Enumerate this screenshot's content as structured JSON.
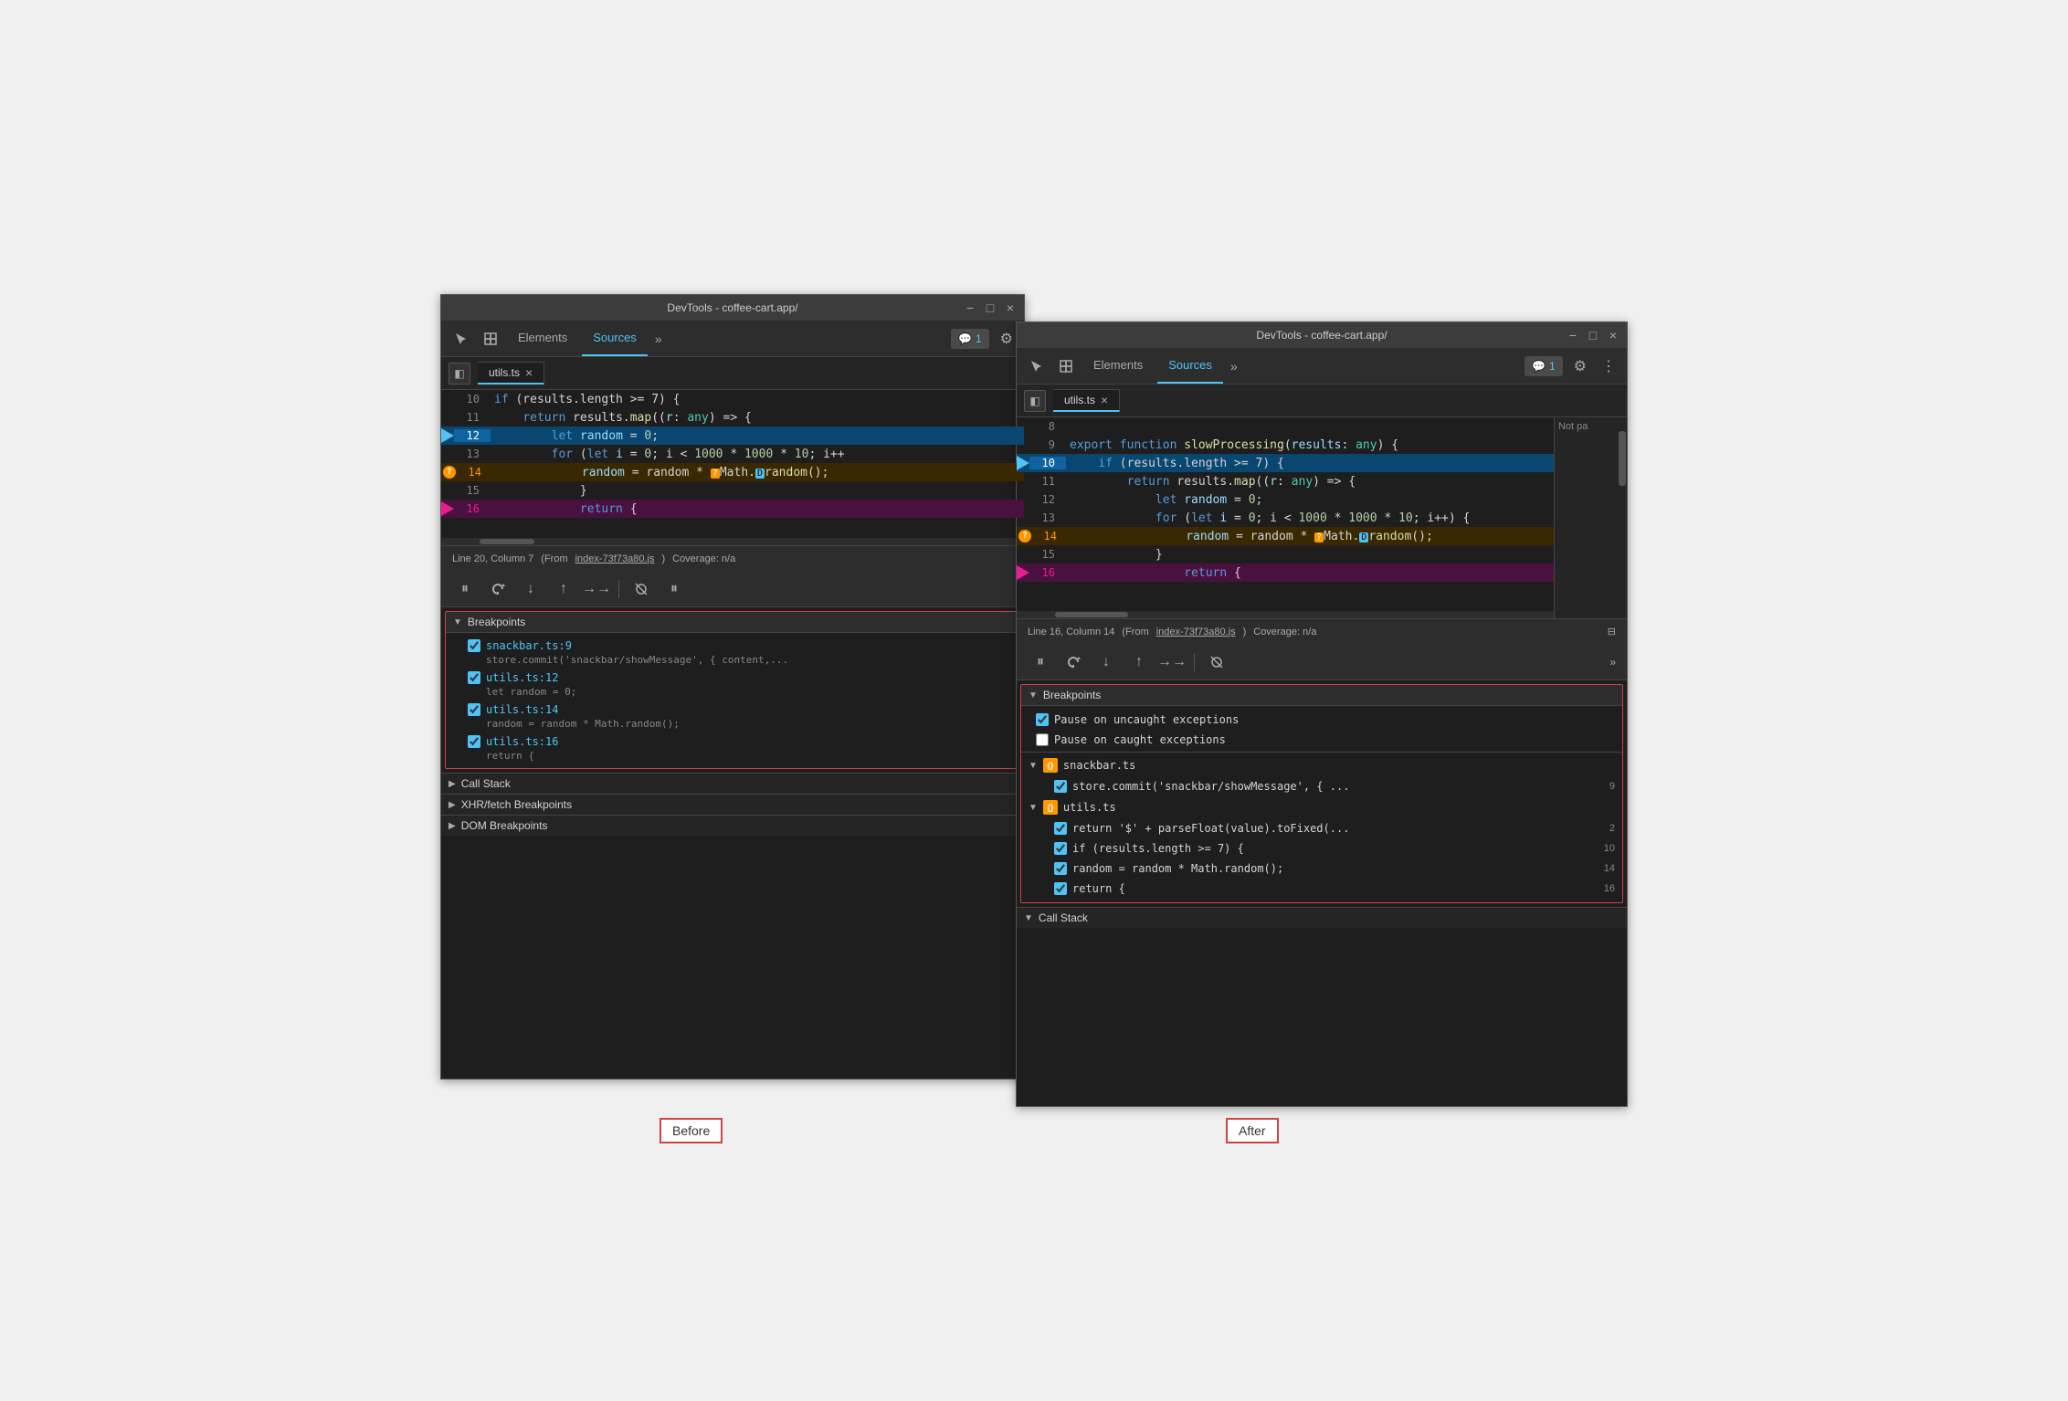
{
  "left_panel": {
    "title": "DevTools - coffee-cart.app/",
    "tabs": [
      "Elements",
      "Sources"
    ],
    "active_tab": "Sources",
    "file_tab": "utils.ts",
    "status": {
      "position": "Line 20, Column 7",
      "source": "index-73f73a80.js",
      "coverage": "Coverage: n/a"
    },
    "code_lines": [
      {
        "num": "10",
        "content": "  if (results.length >= 7) {",
        "highlight": "none",
        "bp": "none"
      },
      {
        "num": "11",
        "content": "    return results.map((r: any) => {",
        "highlight": "none",
        "bp": "none"
      },
      {
        "num": "12",
        "content": "      let random = 0;",
        "highlight": "blue",
        "bp": "arrow"
      },
      {
        "num": "13",
        "content": "      for (let i = 0; i < 1000 * 1000 * 10; i++",
        "highlight": "none",
        "bp": "none"
      },
      {
        "num": "14",
        "content": "        random = random * ❓Math.▷random();",
        "highlight": "orange",
        "bp": "question"
      },
      {
        "num": "15",
        "content": "      }",
        "highlight": "none",
        "bp": "none"
      },
      {
        "num": "16",
        "content": "      return {",
        "highlight": "pink",
        "bp": "pink"
      }
    ],
    "breakpoints": {
      "title": "Breakpoints",
      "items": [
        {
          "name": "snackbar.ts:9",
          "code": "store.commit('snackbar/showMessage', { content,...",
          "checked": true
        },
        {
          "name": "utils.ts:12",
          "code": "let random = 0;",
          "checked": true
        },
        {
          "name": "utils.ts:14",
          "code": "random = random * Math.random();",
          "checked": true
        },
        {
          "name": "utils.ts:16",
          "code": "return {",
          "checked": true
        }
      ]
    },
    "call_stack": {
      "title": "Call Stack"
    },
    "xhr_breakpoints": {
      "title": "XHR/fetch Breakpoints"
    },
    "dom_breakpoints": {
      "title": "DOM Breakpoints"
    },
    "label": "Before"
  },
  "right_panel": {
    "title": "DevTools - coffee-cart.app/",
    "tabs": [
      "Elements",
      "Sources"
    ],
    "active_tab": "Sources",
    "file_tab": "utils.ts",
    "status": {
      "position": "Line 16, Column 14",
      "source": "index-73f73a80.js",
      "coverage": "Coverage: n/a"
    },
    "code_lines": [
      {
        "num": "8",
        "content": "",
        "highlight": "none",
        "bp": "none"
      },
      {
        "num": "9",
        "content": "export function slowProcessing(results: any) {",
        "highlight": "none",
        "bp": "none"
      },
      {
        "num": "10",
        "content": "  if (results.length >= 7) {",
        "highlight": "blue",
        "bp": "arrow"
      },
      {
        "num": "11",
        "content": "    return results.map((r: any) => {",
        "highlight": "none",
        "bp": "none"
      },
      {
        "num": "12",
        "content": "      let random = 0;",
        "highlight": "none",
        "bp": "none"
      },
      {
        "num": "13",
        "content": "      for (let i = 0; i < 1000 * 1000 * 10; i++) {",
        "highlight": "none",
        "bp": "none"
      },
      {
        "num": "14",
        "content": "        random = random * ❓Math.▷random();",
        "highlight": "orange",
        "bp": "question"
      },
      {
        "num": "15",
        "content": "      }",
        "highlight": "none",
        "bp": "none"
      },
      {
        "num": "16",
        "content": "      return {",
        "highlight": "pink",
        "bp": "pink"
      }
    ],
    "breakpoints": {
      "title": "Breakpoints",
      "pause_uncaught": "Pause on uncaught exceptions",
      "pause_caught": "Pause on caught exceptions",
      "groups": [
        {
          "name": "snackbar.ts",
          "items": [
            {
              "code": "store.commit('snackbar/showMessage', { ...",
              "line": "9",
              "checked": true
            }
          ]
        },
        {
          "name": "utils.ts",
          "items": [
            {
              "code": "return '$' + parseFloat(value).toFixed(...",
              "line": "2",
              "checked": true
            },
            {
              "code": "if (results.length >= 7) {",
              "line": "10",
              "checked": true
            },
            {
              "code": "random = random * Math.random();",
              "line": "14",
              "checked": true
            },
            {
              "code": "return {",
              "line": "16",
              "checked": true
            }
          ]
        }
      ]
    },
    "call_stack": {
      "title": "Call Stack"
    },
    "label": "After",
    "side_panel": "Not pa"
  },
  "icons": {
    "cursor": "⬆",
    "layers": "⧉",
    "elements": "Elements",
    "sources": "Sources",
    "chevron_right": "»",
    "settings": "⚙",
    "more": "⋮",
    "badge_icon": "💬",
    "sidebar": "◧",
    "pause": "⏸",
    "step_over": "↺",
    "step_into": "↓",
    "step_out": "↑",
    "continue": "→→",
    "deactivate": "⛔",
    "pause_async": "⏸"
  }
}
